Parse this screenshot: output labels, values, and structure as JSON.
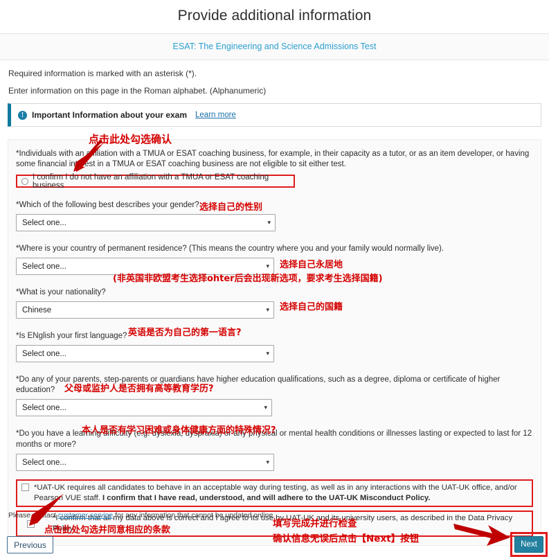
{
  "header": {
    "title": "Provide additional information",
    "subtitle": "ESAT: The Engineering and Science Admissions Test",
    "subtitle_color": "#2b9fd0"
  },
  "intro": {
    "line1": "Required information is marked with an asterisk (*).",
    "line2": "Enter information on this page in the Roman alphabet. (Alphanumeric)"
  },
  "info_banner": {
    "icon": "info-circle-icon",
    "text": "Important Information about your exam",
    "link": "Learn more",
    "accent_color": "#0b7a9e"
  },
  "form": {
    "affiliation_note": "*Individuals with an affiliation with a TMUA or ESAT coaching business, for example, in their capacity as a tutor, or as an item developer, or having some financial interest in a TMUA or ESAT coaching business are not eligible to sit either test.",
    "affiliation_confirm": "I confirm I do not have an affiliation with a TMUA or ESAT coaching business",
    "fields": [
      {
        "id": "gender",
        "label": "*Which of the following best describes your gender?",
        "value": "Select one...",
        "placeholder": "Select one..."
      },
      {
        "id": "residence",
        "label": "*Where is your country of permanent residence? (This means the country where you and your family would normally live).",
        "value": "Select one...",
        "placeholder": "Select one..."
      },
      {
        "id": "nationality",
        "label": "*What is your nationality?",
        "value": "Chinese",
        "placeholder": "Select one..."
      },
      {
        "id": "first-language",
        "label": "*Is ENglish your first language?",
        "value": "Select one...",
        "placeholder": "Select one..."
      },
      {
        "id": "parents-education",
        "label": "*Do any of your parents, step-parents or guardians have higher education qualifications, such as a degree, diploma or certificate of higher education?",
        "value": "Select one...",
        "placeholder": "Select one..."
      },
      {
        "id": "learning-difficulty",
        "label": "*Do you have a learning difficulty (e.g. dyslexia, dyspraxia) or any physical or mental health conditions or illnesses lasting or expected to last for 12 months or more?",
        "value": "Select one...",
        "placeholder": "Select one..."
      }
    ],
    "checkbox_misconduct_normal": "*UAT-UK requires all candidates to behave in an acceptable way during testing, as well as in any interactions with the UAT-UK office, and/or Pearson VUE staff. ",
    "checkbox_misconduct_bold": "I confirm that I have read, understood, and will adhere to the UAT-UK Misconduct Policy.",
    "checkbox_privacy": "*I confirm that all my data above is correct and I agree to its use by UAT-UK and its university users, as described in the Data Privacy Policy."
  },
  "footer": {
    "note_before": "Please contact ",
    "note_link": "customer service",
    "note_after": " for any information that cannot be updated online.",
    "previous_label": "Previous",
    "next_label": "Next",
    "next_color": "#23809f"
  },
  "annotations": {
    "color": "#d50000",
    "items": [
      {
        "id": "anno-confirm-checkbox",
        "text": "点击此处勾选确认"
      },
      {
        "id": "anno-gender",
        "text": "选择自己的性别"
      },
      {
        "id": "anno-residence",
        "text": "选择自己永居地"
      },
      {
        "id": "anno-residence-note",
        "text": "(非英国非欧盟考生选择ohter后会出现新选项，要求考生选择国籍)"
      },
      {
        "id": "anno-nationality",
        "text": "选择自己的国籍"
      },
      {
        "id": "anno-first-language",
        "text": "英语是否为自己的第一语言?"
      },
      {
        "id": "anno-parents-education",
        "text": "父母或监护人是否拥有高等教育学历?"
      },
      {
        "id": "anno-learning-difficulty",
        "text": "本人是否有学习困难或身体健康方面的特殊情况?"
      },
      {
        "id": "anno-agree-terms",
        "text": "点击此处勾选并同意相应的条款"
      },
      {
        "id": "anno-next-line1",
        "text": "填写完成并进行检查"
      },
      {
        "id": "anno-next-line2",
        "text": "确认信息无误后点击【Next】按钮"
      }
    ]
  }
}
